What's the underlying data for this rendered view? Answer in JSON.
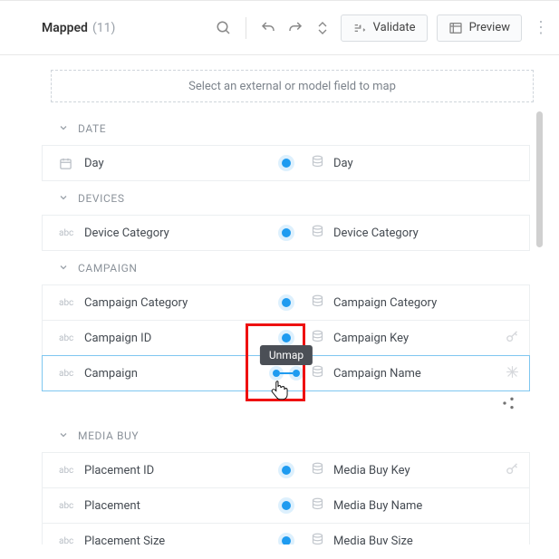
{
  "header": {
    "title": "Mapped",
    "count": "(11)",
    "validate_label": "Validate",
    "preview_label": "Preview"
  },
  "hint_text": "Select an external or model field to map",
  "tooltip_text": "Unmap",
  "groups": [
    {
      "name": "DATE",
      "rows": [
        {
          "left_type": "date",
          "left": "Day",
          "right": "Day",
          "center": "single"
        }
      ]
    },
    {
      "name": "DEVICES",
      "rows": [
        {
          "left_type": "abc",
          "left": "Device Category",
          "right": "Device Category",
          "center": "single"
        }
      ]
    },
    {
      "name": "CAMPAIGN",
      "rows": [
        {
          "left_type": "abc",
          "left": "Campaign Category",
          "right": "Campaign Category",
          "center": "single"
        },
        {
          "left_type": "abc",
          "left": "Campaign ID",
          "right": "Campaign Key",
          "center": "single",
          "trail": "key"
        },
        {
          "left_type": "abc",
          "left": "Campaign",
          "right": "Campaign Name",
          "center": "double",
          "selected": true,
          "trail": "star"
        }
      ],
      "group_trail": "share"
    },
    {
      "name": "MEDIA BUY",
      "rows": [
        {
          "left_type": "abc",
          "left": "Placement ID",
          "right": "Media Buy Key",
          "center": "single",
          "trail": "key"
        },
        {
          "left_type": "abc",
          "left": "Placement",
          "right": "Media Buy Name",
          "center": "single"
        },
        {
          "left_type": "abc",
          "left": "Placement Size",
          "right": "Media Buy Size",
          "center": "single"
        }
      ]
    }
  ]
}
